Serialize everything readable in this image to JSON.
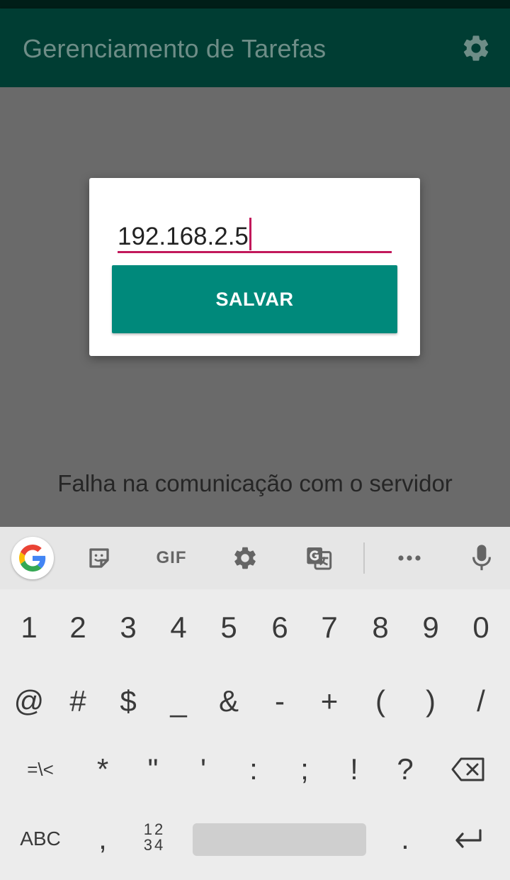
{
  "app": {
    "title": "Gerenciamento de Tarefas",
    "settings_icon": "gear-icon",
    "status_message": "Falha na comunicação com o servidor"
  },
  "dialog": {
    "ip_value": "192.168.2.5",
    "save_label": "SALVAR"
  },
  "keyboard": {
    "toolbar": {
      "google": "google-icon",
      "sticker": "sticker-icon",
      "gif": "GIF",
      "settings": "gear-icon",
      "translate": "translate-icon",
      "more": "more-icon",
      "mic": "mic-icon"
    },
    "row1": [
      "1",
      "2",
      "3",
      "4",
      "5",
      "6",
      "7",
      "8",
      "9",
      "0"
    ],
    "row2": [
      "@",
      "#",
      "$",
      "_",
      "&",
      "-",
      "+",
      "(",
      ")",
      "/"
    ],
    "row3": [
      "=\\<",
      "*",
      "\"",
      "'",
      ":",
      ";",
      "!",
      "?"
    ],
    "row4": {
      "abc": "ABC",
      "comma": ",",
      "numpad_top": "12",
      "numpad_bottom": "34",
      "period": "."
    }
  },
  "colors": {
    "appbar": "#003d33",
    "accent": "#c2185b",
    "button": "#00897b"
  }
}
